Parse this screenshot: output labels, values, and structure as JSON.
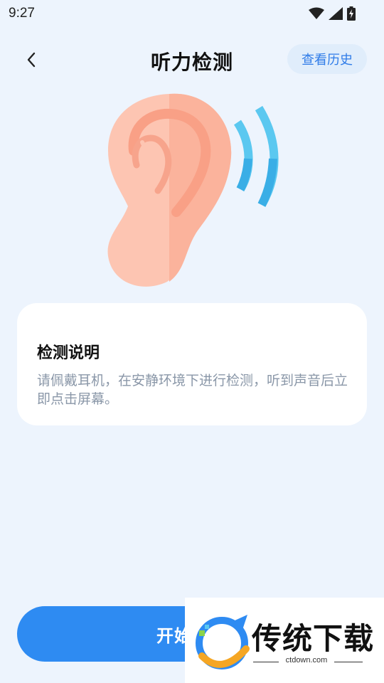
{
  "status_bar": {
    "time": "9:27",
    "icons": [
      "wifi-icon",
      "signal-icon",
      "battery-charging-icon"
    ]
  },
  "header": {
    "back_icon": "chevron-left-icon",
    "title": "听力检测",
    "history_label": "查看历史"
  },
  "illustration": {
    "icon": "ear-with-sound-waves-icon"
  },
  "instruction_card": {
    "title": "检测说明",
    "body": "请佩戴耳机，在安静环境下进行检测，听到声音后立即点击屏幕。"
  },
  "start_button": {
    "label": "开始检测"
  },
  "watermark": {
    "text": "传统下载",
    "url": "ctdown.com"
  },
  "colors": {
    "background": "#EDF4FD",
    "accent": "#2E8BF2",
    "history_button_bg": "#E0EDFB",
    "history_button_text": "#2F7CE8",
    "ear": "#FDBCA8",
    "ear_inner": "#F9A086",
    "sound_waves": "#5BC8F0"
  }
}
